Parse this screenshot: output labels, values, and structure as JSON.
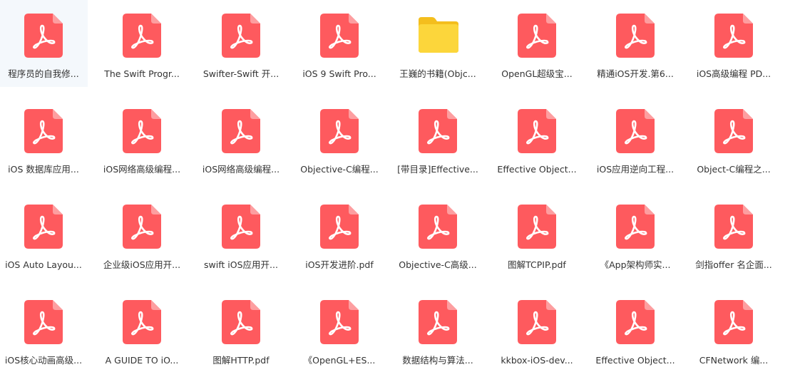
{
  "colors": {
    "pdf_body": "#fe5a5e",
    "pdf_fold": "#fd9ea0",
    "pdf_mark": "#ffffff",
    "folder_back": "#f4be1d",
    "folder_front": "#fcd63b",
    "label_text": "#333333",
    "selection_bg": "#f4f8fc"
  },
  "files": [
    {
      "name": "程序员的自我修...",
      "icon": "pdf-icon",
      "selected": true
    },
    {
      "name": "The Swift Progr...",
      "icon": "pdf-icon"
    },
    {
      "name": "Swifter-Swift 开...",
      "icon": "pdf-icon"
    },
    {
      "name": "iOS 9 Swift Pro...",
      "icon": "pdf-icon"
    },
    {
      "name": "王巍的书籍(Objc...",
      "icon": "folder-icon"
    },
    {
      "name": "OpenGL超级宝...",
      "icon": "pdf-icon"
    },
    {
      "name": "精通iOS开发.第6...",
      "icon": "pdf-icon"
    },
    {
      "name": "iOS高级编程 PD...",
      "icon": "pdf-icon"
    },
    {
      "name": "iOS 数据库应用...",
      "icon": "pdf-icon"
    },
    {
      "name": "iOS网络高级编程...",
      "icon": "pdf-icon"
    },
    {
      "name": "iOS网络高级编程...",
      "icon": "pdf-icon"
    },
    {
      "name": "Objective-C编程...",
      "icon": "pdf-icon"
    },
    {
      "name": "[带目录]Effective...",
      "icon": "pdf-icon"
    },
    {
      "name": "Effective Object...",
      "icon": "pdf-icon"
    },
    {
      "name": "iOS应用逆向工程...",
      "icon": "pdf-icon"
    },
    {
      "name": "Object-C编程之...",
      "icon": "pdf-icon"
    },
    {
      "name": "iOS Auto Layou...",
      "icon": "pdf-icon"
    },
    {
      "name": "企业级iOS应用开...",
      "icon": "pdf-icon"
    },
    {
      "name": "swift iOS应用开...",
      "icon": "pdf-icon"
    },
    {
      "name": "iOS开发进阶.pdf",
      "icon": "pdf-icon"
    },
    {
      "name": "Objective-C高级...",
      "icon": "pdf-icon"
    },
    {
      "name": "图解TCPIP.pdf",
      "icon": "pdf-icon"
    },
    {
      "name": "《App架构师实...",
      "icon": "pdf-icon"
    },
    {
      "name": "剑指offer 名企面...",
      "icon": "pdf-icon"
    },
    {
      "name": "iOS核心动画高级...",
      "icon": "pdf-icon"
    },
    {
      "name": "A GUIDE TO iO...",
      "icon": "pdf-icon"
    },
    {
      "name": "图解HTTP.pdf",
      "icon": "pdf-icon"
    },
    {
      "name": "《OpenGL+ES...",
      "icon": "pdf-icon"
    },
    {
      "name": "数据结构与算法...",
      "icon": "pdf-icon"
    },
    {
      "name": "kkbox-iOS-dev...",
      "icon": "pdf-icon"
    },
    {
      "name": "Effective Object...",
      "icon": "pdf-icon"
    },
    {
      "name": "CFNetwork 编...",
      "icon": "pdf-icon"
    }
  ]
}
